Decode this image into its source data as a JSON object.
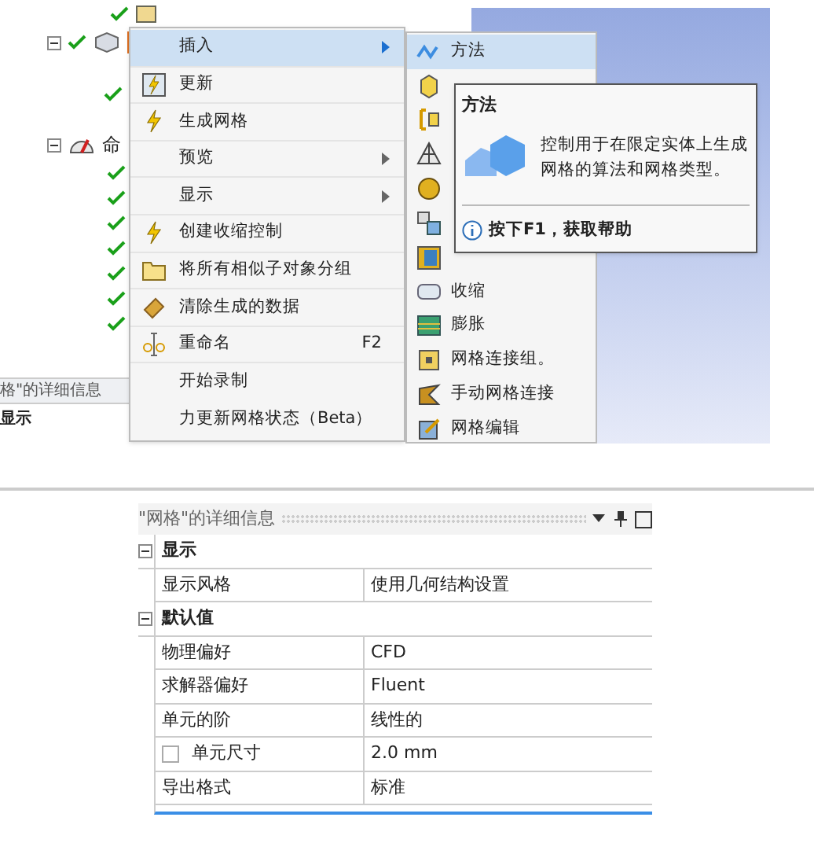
{
  "tree": {
    "label": "命",
    "expanded": true
  },
  "context_menu": {
    "items": [
      {
        "label": "插入",
        "kind": "plain",
        "submenu": true,
        "selected": true
      },
      {
        "label": "更新",
        "kind": "update",
        "submenu": false,
        "selected": false
      },
      {
        "label": "生成网格",
        "kind": "bolt",
        "submenu": false,
        "selected": false
      },
      {
        "label": "预览",
        "kind": "plain",
        "submenu": true,
        "selected": false
      },
      {
        "label": "显示",
        "kind": "plain",
        "submenu": true,
        "selected": false
      },
      {
        "label": "创建收缩控制",
        "kind": "bolt",
        "submenu": false,
        "selected": false
      },
      {
        "label": "将所有相似子对象分组",
        "kind": "folder",
        "submenu": false,
        "selected": false
      },
      {
        "label": "清除生成的数据",
        "kind": "eraser",
        "submenu": false,
        "selected": false
      },
      {
        "label": "重命名",
        "kind": "rename",
        "submenu": false,
        "selected": false,
        "shortcut": "F2"
      },
      {
        "label": "开始录制",
        "kind": "plain",
        "submenu": false,
        "selected": false
      },
      {
        "label": "力更新网格状态（Beta）",
        "kind": "plain",
        "submenu": false,
        "selected": false
      }
    ]
  },
  "submenu": {
    "items": [
      {
        "label": "方法",
        "kind": "method",
        "selected": true
      },
      {
        "kind": "cube",
        "selected": false
      },
      {
        "kind": "bracket",
        "selected": false
      },
      {
        "kind": "triangle",
        "selected": false
      },
      {
        "kind": "sphere",
        "selected": false
      },
      {
        "kind": "cubes",
        "selected": false
      },
      {
        "kind": "block",
        "selected": false
      },
      {
        "label": "收缩",
        "kind": "shrink",
        "selected": false
      },
      {
        "label": "膨胀",
        "kind": "inflate",
        "selected": false
      },
      {
        "label": "网格连接组。",
        "kind": "group",
        "selected": false
      },
      {
        "label": "手动网格连接",
        "kind": "connect",
        "selected": false
      },
      {
        "label": "网格编辑",
        "kind": "edit",
        "selected": false
      }
    ]
  },
  "tooltip": {
    "title": "方法",
    "body": "控制用于在限定实体上生成网格的算法和网格类型。",
    "help": "按下F1，获取帮助"
  },
  "details_strip": {
    "title": "格\"的详细信息",
    "section": "显示"
  },
  "details": {
    "title": "\"网格\"的详细信息",
    "sections": [
      {
        "title": "显示",
        "expanded": true,
        "rows": [
          {
            "name": "显示风格",
            "value": "使用几何结构设置"
          }
        ]
      },
      {
        "title": "默认值",
        "expanded": true,
        "rows": [
          {
            "name": "物理偏好",
            "value": "CFD"
          },
          {
            "name": "求解器偏好",
            "value": "Fluent"
          },
          {
            "name": "单元的阶",
            "value": "线性的"
          },
          {
            "name": "单元尺寸",
            "value": "2.0 mm",
            "checked": false
          },
          {
            "name": "导出格式",
            "value": "标准"
          }
        ]
      }
    ]
  }
}
